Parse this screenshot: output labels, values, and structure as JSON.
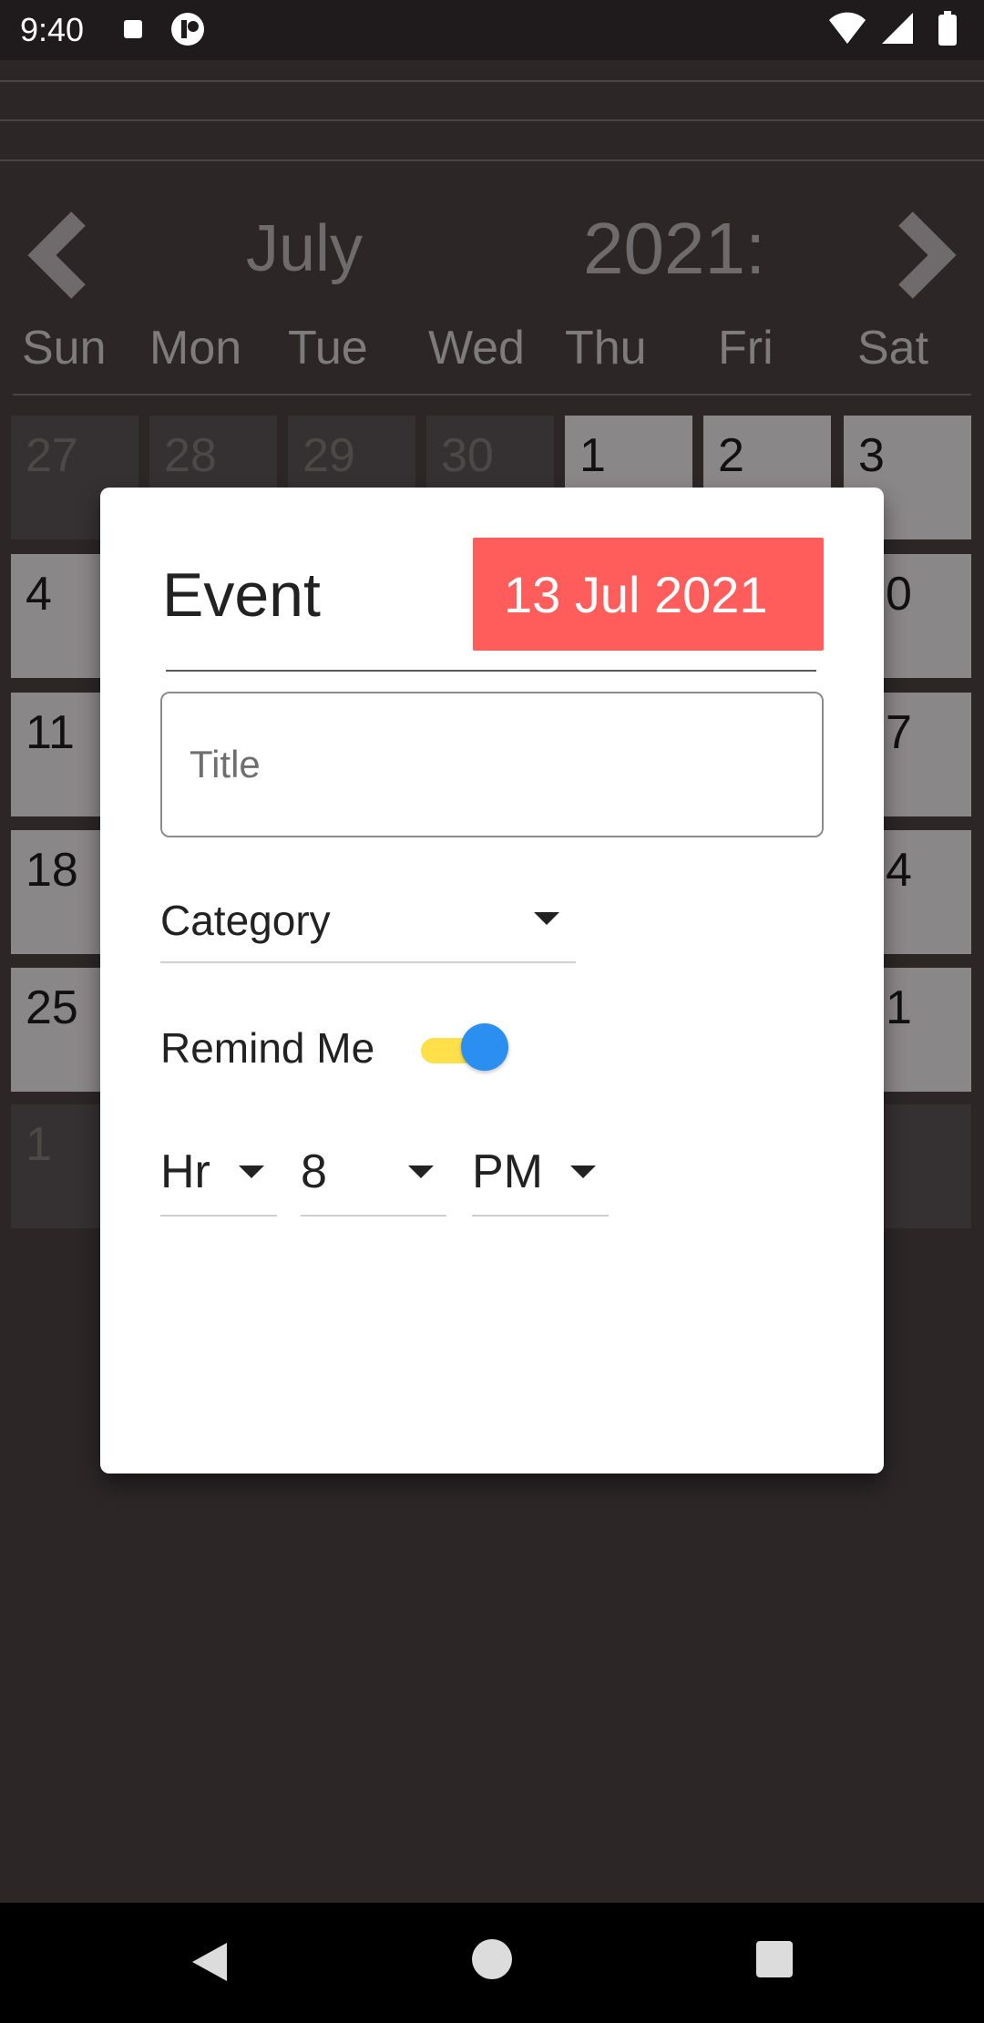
{
  "status_bar": {
    "time": "9:40",
    "icons": [
      "stop-icon",
      "app-icon",
      "wifi-icon",
      "signal-icon",
      "battery-icon"
    ]
  },
  "calendar": {
    "month": "July",
    "year": "2021:",
    "weekdays": [
      "Sun",
      "Mon",
      "Tue",
      "Wed",
      "Thu",
      "Fri",
      "Sat"
    ],
    "visible_cells": {
      "row1": [
        "27",
        "28",
        "29",
        "30",
        "1",
        "2",
        "3"
      ],
      "col_sun": [
        "4",
        "11",
        "18",
        "25",
        "1"
      ],
      "col_sat": [
        "0",
        "7",
        "4",
        "1"
      ]
    }
  },
  "dialog": {
    "title": "Event",
    "date": "13 Jul 2021",
    "title_placeholder": "Title",
    "category_label": "Category",
    "remind_label": "Remind Me",
    "remind_enabled": true,
    "hour_label": "Hr",
    "hour_value": "8",
    "ampm_value": "PM"
  },
  "colors": {
    "date_badge": "#ff5c5c",
    "switch_thumb": "#2b8ef1",
    "switch_track": "#ffe04b",
    "background": "#2c2627"
  }
}
